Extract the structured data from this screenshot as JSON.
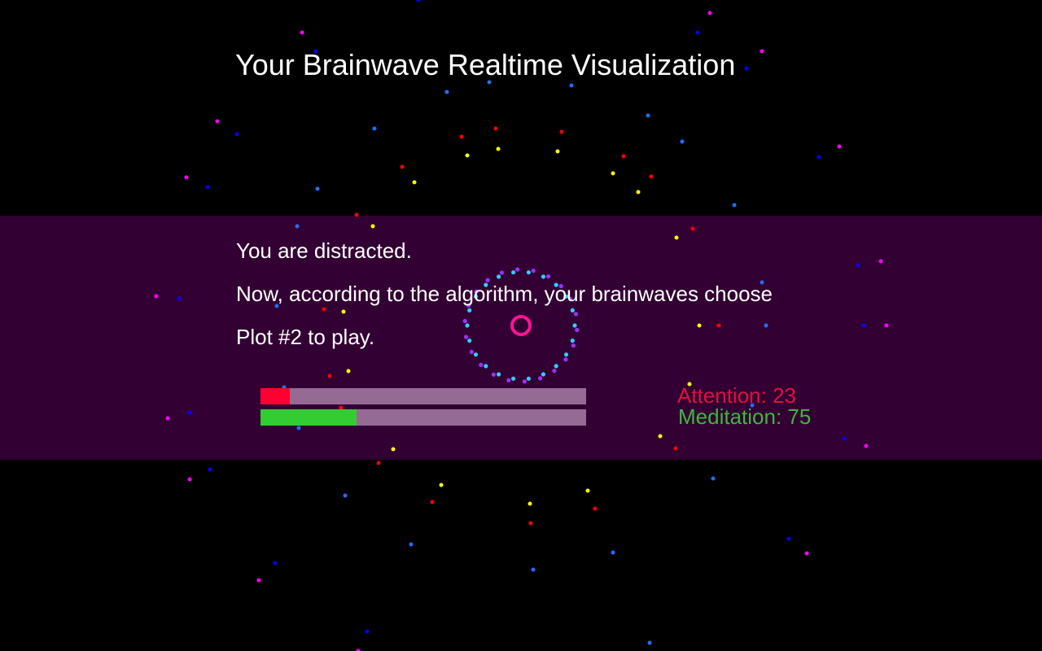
{
  "title": "Your Brainwave Realtime Visualization",
  "status": {
    "line1": "You are distracted.",
    "line2": "Now, according to the algorithm, your brainwaves choose",
    "line3": "Plot #2 to play."
  },
  "meters": {
    "attention": {
      "label": "Attention: 23",
      "value": 23,
      "max": 100,
      "color": "#ff0033"
    },
    "meditation": {
      "label": "Meditation: 75",
      "value": 75,
      "max": 100,
      "color": "#33cc33"
    }
  },
  "colors": {
    "background": "#000000",
    "band": "#330033",
    "track": "#956a95",
    "text": "#ffffff",
    "attention_text": "#e0103c",
    "meditation_text": "#3cb83c",
    "particle_palette": [
      "#ff0000",
      "#ffff00",
      "#0000ff",
      "#1e6fff",
      "#ff00ff",
      "#ff1493"
    ]
  }
}
